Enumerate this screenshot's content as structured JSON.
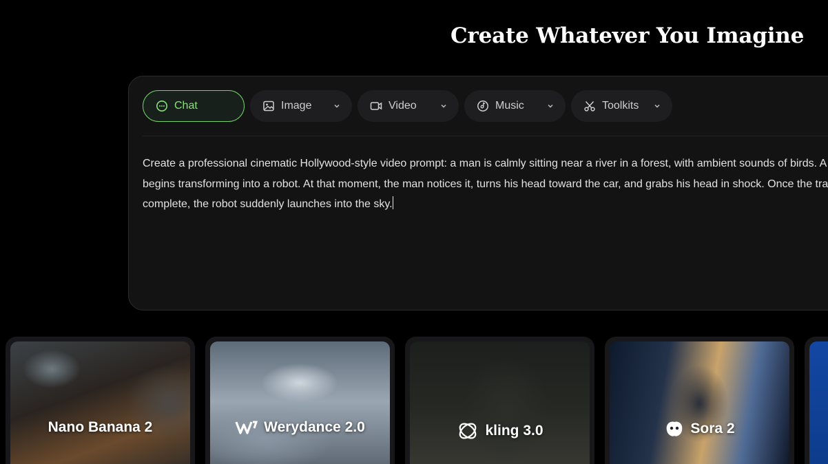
{
  "hero": {
    "title": "Create Whatever You Imagine"
  },
  "composer": {
    "tabs": [
      {
        "label": "Chat"
      },
      {
        "label": "Image"
      },
      {
        "label": "Video"
      },
      {
        "label": "Music"
      },
      {
        "label": "Toolkits"
      }
    ],
    "prompt": "Create a professional cinematic Hollywood-style video prompt: a man is calmly sitting near a river in a forest, with ambient sounds of birds. A nearby car begins transforming into a robot. At that moment, the man notices it, turns his head toward the car, and grabs his head in shock. Once the transformation is complete, the robot suddenly launches into the sky."
  },
  "models": [
    {
      "label": "Nano Banana 2"
    },
    {
      "label": "Werydance 2.0"
    },
    {
      "label": "kling 3.0"
    },
    {
      "label": "Sora 2"
    },
    {
      "label": ""
    }
  ],
  "colors": {
    "background": "#000000",
    "panel": "#131314",
    "accent": "#74d16a"
  },
  "icons": {
    "chat": "chat-bubble-icon",
    "image": "image-icon",
    "video": "video-camera-icon",
    "music": "music-disc-icon",
    "toolkits": "scissors-icon",
    "dropdown": "chevron-down-icon"
  }
}
